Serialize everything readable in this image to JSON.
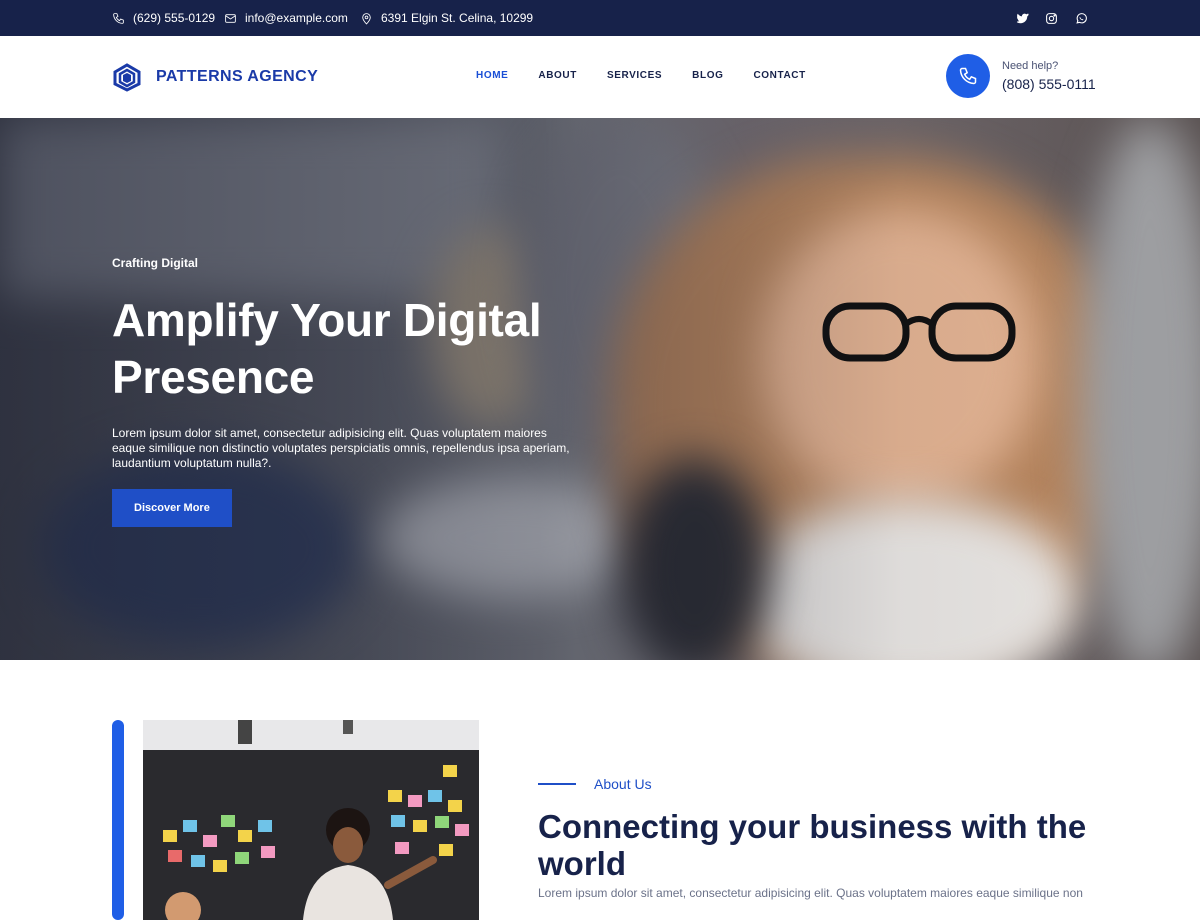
{
  "topbar": {
    "phone": "(629) 555-0129",
    "email": "info@example.com",
    "address": "6391 Elgin St. Celina, 10299",
    "social": [
      "twitter-icon",
      "instagram-icon",
      "whatsapp-icon"
    ]
  },
  "header": {
    "logo_text": "PATTERNS AGENCY",
    "nav": [
      {
        "label": "HOME",
        "active": true
      },
      {
        "label": "ABOUT",
        "active": false
      },
      {
        "label": "SERVICES",
        "active": false
      },
      {
        "label": "BLOG",
        "active": false
      },
      {
        "label": "CONTACT",
        "active": false
      }
    ],
    "help_label": "Need help?",
    "help_phone": "(808) 555-0111"
  },
  "hero": {
    "kicker": "Crafting Digital",
    "title_line1": "Amplify Your Digital",
    "title_line2": "Presence",
    "text": "Lorem ipsum dolor sit amet, consectetur adipisicing elit. Quas voluptatem maiores eaque similique non distinctio voluptates perspiciatis omnis, repellendus ipsa aperiam, laudantium voluptatum nulla?.",
    "button": "Discover More"
  },
  "about": {
    "label": "About Us",
    "title": "Connecting your business with the world",
    "text": "Lorem ipsum dolor sit amet, consectetur adipisicing elit. Quas voluptatem maiores eaque similique non"
  },
  "colors": {
    "accent": "#1f5ee6",
    "button": "#1f4fc7",
    "topbar": "#17224a",
    "heading": "#17224a"
  }
}
